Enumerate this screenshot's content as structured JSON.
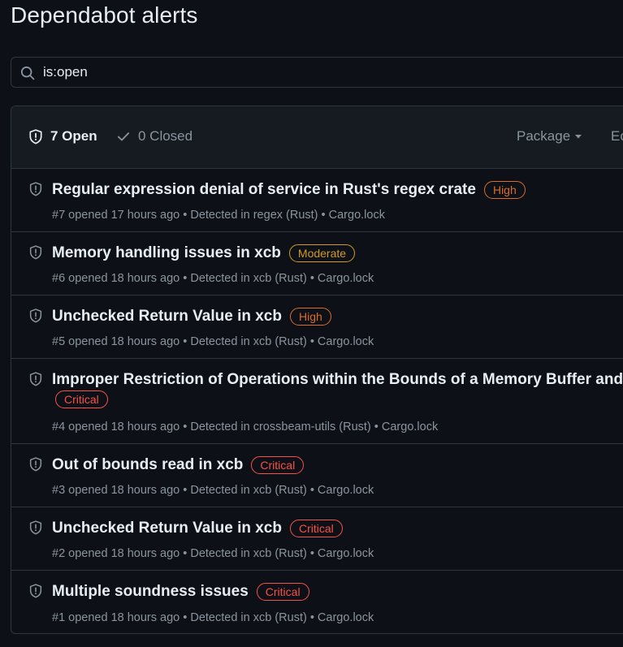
{
  "page": {
    "title": "Dependabot alerts"
  },
  "search": {
    "value": "is:open",
    "icon": "search-icon"
  },
  "header": {
    "open_label": "7 Open",
    "closed_label": "0 Closed",
    "package_label": "Package",
    "ecosystem_label": "Ecosystem"
  },
  "colors": {
    "high": "#db6d28",
    "moderate": "#d29922",
    "critical": "#f85149",
    "background": "#0d1117",
    "header_bg": "#161b22"
  },
  "alerts": [
    {
      "title": "Regular expression denial of service in Rust's regex crate",
      "severity": "High",
      "meta": "#7 opened 17 hours ago • Detected in regex (Rust) • Cargo.lock"
    },
    {
      "title": "Memory handling issues in xcb",
      "severity": "Moderate",
      "meta": "#6 opened 18 hours ago • Detected in xcb (Rust) • Cargo.lock"
    },
    {
      "title": "Unchecked Return Value in xcb",
      "severity": "High",
      "meta": "#5 opened 18 hours ago • Detected in xcb (Rust) • Cargo.lock"
    },
    {
      "title": "Improper Restriction of Operations within the Bounds of a Memory Buffer and",
      "severity": "Critical",
      "meta": "#4 opened 18 hours ago • Detected in crossbeam-utils (Rust) • Cargo.lock"
    },
    {
      "title": "Out of bounds read in xcb",
      "severity": "Critical",
      "meta": "#3 opened 18 hours ago • Detected in xcb (Rust) • Cargo.lock"
    },
    {
      "title": "Unchecked Return Value in xcb",
      "severity": "Critical",
      "meta": "#2 opened 18 hours ago • Detected in xcb (Rust) • Cargo.lock"
    },
    {
      "title": "Multiple soundness issues",
      "severity": "Critical",
      "meta": "#1 opened 18 hours ago • Detected in xcb (Rust) • Cargo.lock"
    }
  ]
}
